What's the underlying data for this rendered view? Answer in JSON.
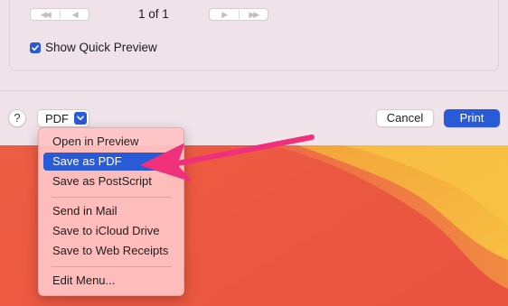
{
  "pager": {
    "first_prev_glyphs": [
      "◀◀",
      "◀"
    ],
    "next_last_glyphs": [
      "▶",
      "▶▶"
    ],
    "page_count": "1 of 1"
  },
  "quick_preview": {
    "label": "Show Quick Preview",
    "checked": true
  },
  "footer": {
    "help_label": "?",
    "pdf_label": "PDF",
    "cancel_label": "Cancel",
    "print_label": "Print"
  },
  "pdf_menu": {
    "items": [
      {
        "label": "Open in Preview",
        "selected": false
      },
      {
        "label": "Save as PDF",
        "selected": true
      },
      {
        "label": "Save as PostScript",
        "selected": false
      },
      {
        "label": "Send in Mail",
        "selected": false
      },
      {
        "label": "Save to iCloud Drive",
        "selected": false
      },
      {
        "label": "Save to Web Receipts",
        "selected": false
      },
      {
        "label": "Edit Menu...",
        "selected": false
      }
    ]
  },
  "colors": {
    "accent": "#2a5bd7",
    "annotation_arrow": "#f0307a",
    "dialog_bg": "#f1e3ea",
    "wallpaper_red": "#ec5b45",
    "wallpaper_yellow": "#f6b73f"
  }
}
